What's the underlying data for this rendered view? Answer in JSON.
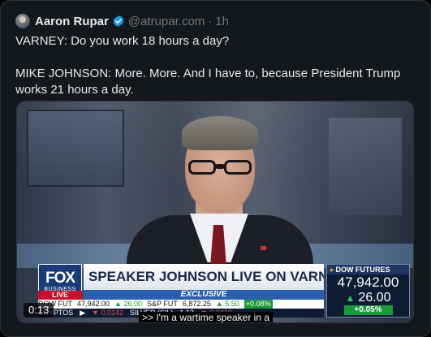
{
  "tweet": {
    "display_name": "Aaron Rupar",
    "handle": "@atrupar.com",
    "separator": "·",
    "time": "1h",
    "paragraphs": [
      "VARNEY: Do you work 18 hours a day?",
      "MIKE JOHNSON: More. More. And I have to, because President Trump works 21 hours a day."
    ]
  },
  "video": {
    "timestamp": "0:13",
    "caption": ">> I'm a wartime speaker in a",
    "overlay": {
      "logo_word": "FOX",
      "logo_sub": "BUSINESS",
      "live_label": "LIVE",
      "headline": "SPEAKER JOHNSON LIVE ON VARNEY",
      "exclusive_label": "EXCLUSIVE",
      "ticker_top": [
        "DOW FUT",
        "47,942.00",
        "▲ 26.00",
        "S&P FUT",
        "6,872.25",
        "▲ 5.50",
        "+0.08%"
      ],
      "ticker_bottom": [
        "CRYPTOS",
        "▶",
        "▼ 0.0142",
        "SILVER (SIL)",
        "1.12",
        "▼ 0.0410"
      ],
      "futures_label": "DOW FUTURES",
      "futures_value": "47,942.00",
      "futures_change": "26.00",
      "futures_pct": "+0.05%"
    }
  },
  "colors": {
    "background": "#14181c",
    "text": "#e7e9ea",
    "muted": "#71767b",
    "verified": "#1d9bf0",
    "fox_blue": "#1a3b7a",
    "live_red": "#c8102e",
    "gain_green": "#1a9a3a"
  },
  "icons": {
    "verified": "verified-badge-icon",
    "avatar": "avatar"
  }
}
